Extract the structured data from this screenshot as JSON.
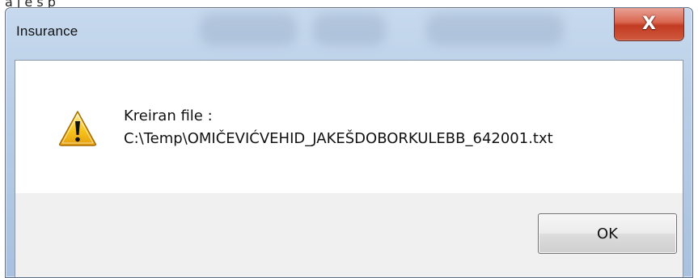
{
  "background_window": {
    "partial_text": "a        j        e        s        p"
  },
  "dialog": {
    "title": "Insurance",
    "close_glyph": "X",
    "icon": "warning-icon",
    "message_line1": "Kreiran file :",
    "message_line2": "C:\\Temp\\OMIČEVIĆVEHID_JAKEŠDOBORKULEBB_642001.txt",
    "ok_label": "OK"
  },
  "colors": {
    "frame_glass": "#b8cde6",
    "close_button_red": "#c23a22",
    "button_area_gray": "#f0f0f0",
    "warning_yellow": "#f7c51f"
  }
}
